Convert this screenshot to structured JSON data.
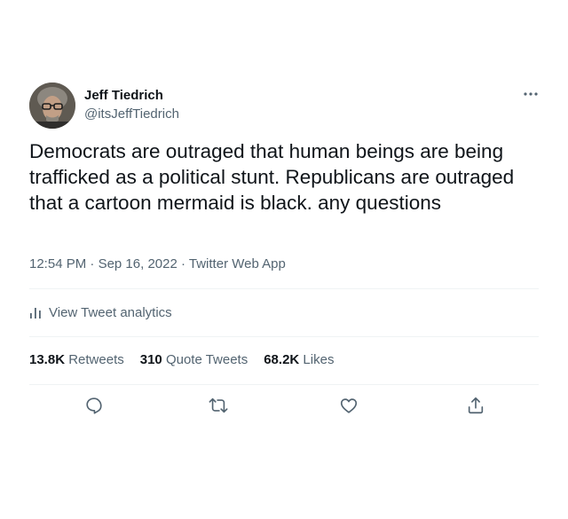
{
  "author": {
    "name": "Jeff Tiedrich",
    "handle": "@itsJeffTiedrich",
    "avatar_icon": "avatar-photo"
  },
  "tweet": {
    "text": "Democrats are outraged that human beings are being trafficked as a political stunt. Republicans are outraged that a cartoon mermaid is black. any questions",
    "time": "12:54 PM",
    "separator": "·",
    "date": "Sep 16, 2022",
    "source": "Twitter Web App"
  },
  "analytics": {
    "label": "View Tweet analytics",
    "icon": "analytics-bars-icon"
  },
  "stats": [
    {
      "count": "13.8K",
      "label": "Retweets"
    },
    {
      "count": "310",
      "label": "Quote Tweets"
    },
    {
      "count": "68.2K",
      "label": "Likes"
    }
  ],
  "actions": {
    "reply_icon": "reply-icon",
    "retweet_icon": "retweet-icon",
    "like_icon": "heart-icon",
    "share_icon": "share-icon"
  },
  "colors": {
    "text_primary": "#0f1419",
    "text_secondary": "#536471",
    "divider": "#eff3f4"
  }
}
